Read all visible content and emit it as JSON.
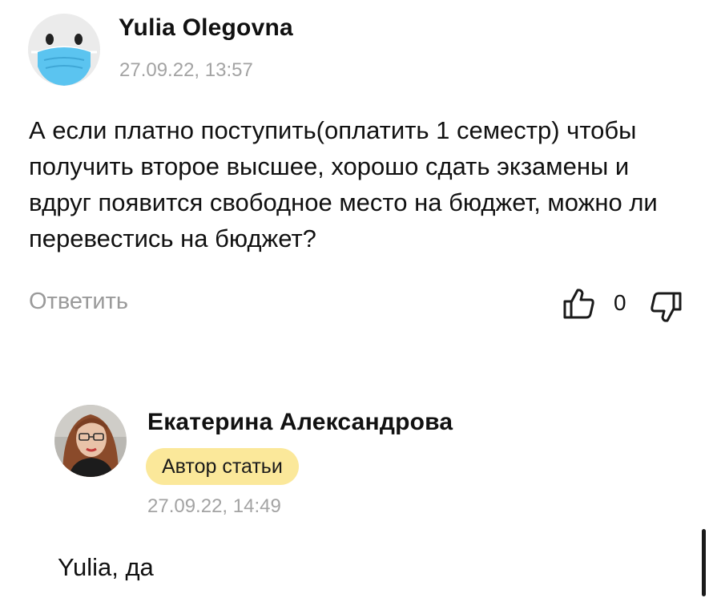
{
  "comments": [
    {
      "author": "Yulia Olegovna",
      "timestamp": "27.09.22, 13:57",
      "text": "А если платно поступить(оплатить 1 семестр) чтобы получить второе высшее, хорошо сдать экзамены и вдруг появится свободное место на бюджет, можно ли перевестись на бюджет?",
      "reply_label": "Ответить",
      "votes": "0",
      "avatar_icon": "masked-face-avatar",
      "avatar_color": "#5bc4f0"
    },
    {
      "author": "Екатерина Александрова",
      "badge": "Автор статьи",
      "timestamp": "27.09.22, 14:49",
      "text": "Yulia, да",
      "avatar_icon": "user-photo-avatar"
    }
  ],
  "colors": {
    "badge_bg": "#fbe89a",
    "muted_text": "#a3a3a3",
    "text": "#111111"
  }
}
